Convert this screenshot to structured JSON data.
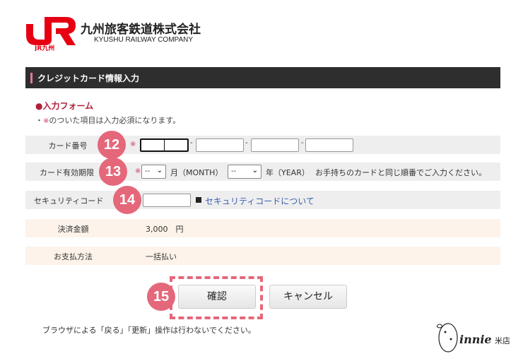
{
  "header": {
    "logo_text": "JR九州",
    "company_jp": "九州旅客鉄道株式会社",
    "company_en": "KYUSHU RAILWAY COMPANY"
  },
  "section_title": "クレジットカード情報入力",
  "form": {
    "heading": "●入力フォーム",
    "note_prefix": "・",
    "note_mark": "※",
    "note_text": "のついた項目は入力必須になります。"
  },
  "rows": {
    "card_number": {
      "label": "カード番号",
      "required": "※",
      "sep": "-"
    },
    "expiry": {
      "label": "カード有効期限",
      "required": "※",
      "month_value": "--",
      "month_label": "月（MONTH）",
      "year_value": "--",
      "year_label": "年（YEAR）",
      "hint": "お手持ちのカードと同じ順番でご入力ください。"
    },
    "security": {
      "label": "セキュリティコード",
      "link": "セキュリティコードについて"
    },
    "amount": {
      "label": "決済金額",
      "value": "3,000　円"
    },
    "payment": {
      "label": "お支払方法",
      "value": "一括払い"
    }
  },
  "badges": [
    "12",
    "13",
    "14",
    "15"
  ],
  "buttons": {
    "confirm": "確認",
    "cancel": "キャンセル"
  },
  "footer": "ブラウザによる「戻る」「更新」操作は行わないでください。",
  "watermark": "Winnie 米店",
  "colors": {
    "brand_red": "#e60012",
    "badge": "#e5677a",
    "bar": "#2e2e2e",
    "link": "#3a5dae"
  }
}
